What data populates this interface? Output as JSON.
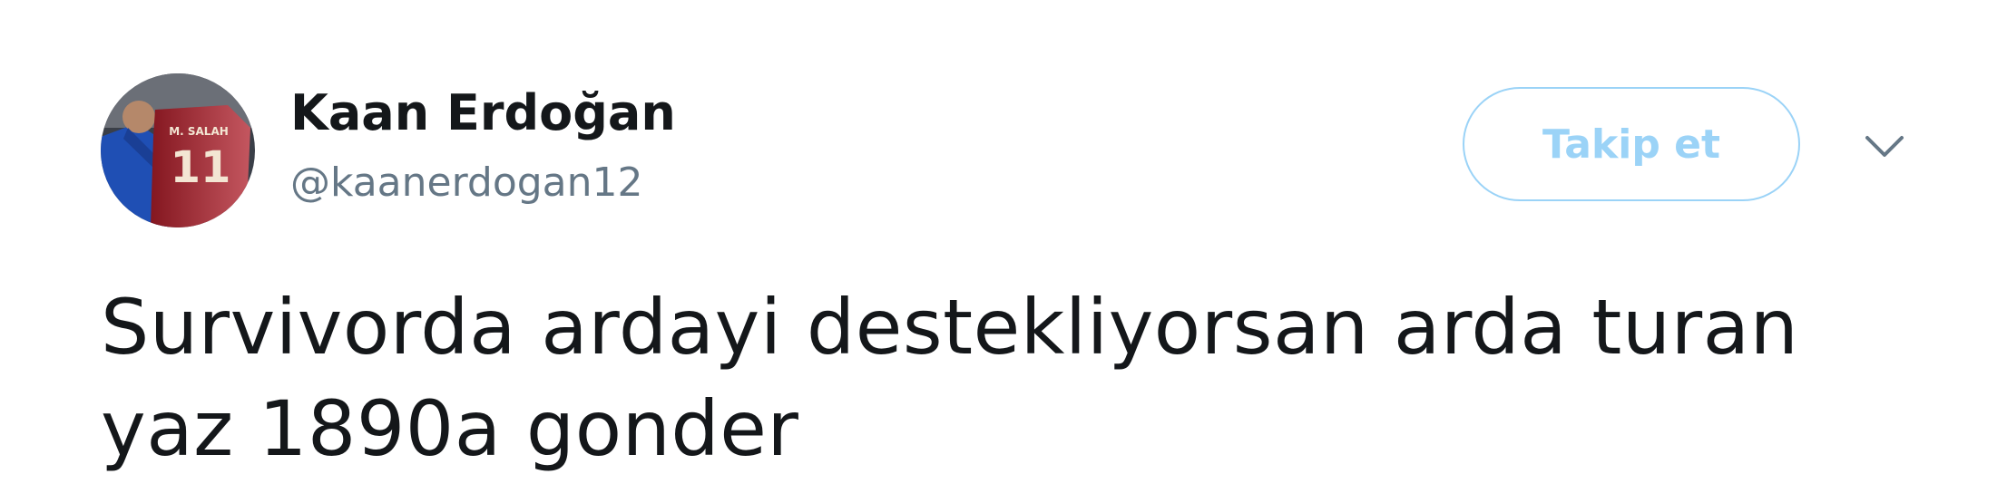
{
  "user": {
    "display_name": "Kaan Erdoğan",
    "handle": "@kaanerdogan12",
    "avatar_jersey_name": "M. SALAH",
    "avatar_jersey_number": "11"
  },
  "follow_button": {
    "label": "Takip et"
  },
  "menu": {
    "icon": "chevron-down-icon"
  },
  "tweet": {
    "text_line_1": "Survivorda ardayi destekliyorsan arda turan",
    "text_line_2": "yaz 1890a gonder"
  },
  "colors": {
    "follow_button_text": "#9bd3f7",
    "follow_button_border": "#9bd3f7",
    "handle": "#657786",
    "text": "#14171a",
    "caret": "#657786"
  }
}
